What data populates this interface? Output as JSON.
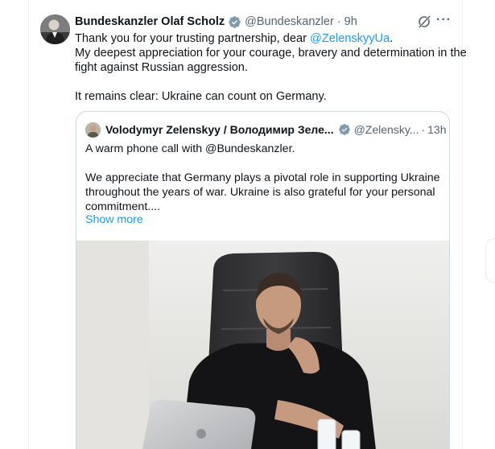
{
  "tweet": {
    "author_name": "Bundeskanzler Olaf Scholz",
    "handle": "@Bundeskanzler",
    "separator": "·",
    "time": "9h",
    "text": {
      "line1_prefix": "Thank you for your trusting partnership, dear ",
      "line1_mention": "@ZelenskyyUa",
      "line1_suffix": ".",
      "line2": "My deepest appreciation for your courage, bravery and determination in the",
      "line3": "fight against Russian aggression.",
      "line4": "It remains clear: Ukraine can count on Germany."
    },
    "more_label": "···"
  },
  "quote": {
    "author_name": "Volodymyr Zelenskyy / Володимир Зеле...",
    "handle": "@Zelensky...",
    "separator": "·",
    "time": "13h",
    "text": {
      "line1": "A warm phone call with @Bundeskanzler.",
      "line2": "We appreciate that Germany plays a pivotal role in supporting Ukraine",
      "line3": "throughout the years of war. Ukraine is also grateful for your personal",
      "line4": "commitment...."
    },
    "show_more": "Show more"
  },
  "colors": {
    "accent": "#1d9bf0",
    "secondary_text": "#536471",
    "border": "#cfd9de",
    "verified_badge": "#829aab"
  },
  "icons": {
    "verified": "verified-badge-icon",
    "grok": "grok-icon",
    "more": "more-icon"
  }
}
